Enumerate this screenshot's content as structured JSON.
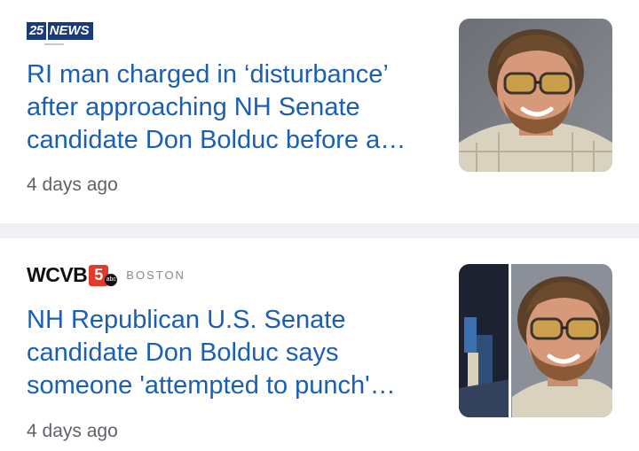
{
  "feed": {
    "articles": [
      {
        "source_logo": {
          "top": "",
          "main": "25",
          "suffix": "NEWS"
        },
        "headline": "RI man charged in ‘disturbance’ after approaching NH Senate candidate Don Bolduc before a…",
        "timestamp": "4 days ago",
        "thumbnail_icon": "person-photo-icon"
      },
      {
        "source_logo": {
          "main": "WCVB",
          "channel": "5",
          "network": "abc",
          "city": "BOSTON"
        },
        "headline": "NH Republican U.S. Senate candidate Don Bolduc says someone 'attempted to punch'…",
        "timestamp": "4 days ago",
        "thumbnail_icon": "person-photo-icon"
      }
    ]
  },
  "colors": {
    "headline": "#1a5fb4",
    "timestamp": "#5f6368",
    "divider": "#eef0f3",
    "wcvb_red": "#e23b2d",
    "news25_blue": "#1a3a7a"
  }
}
